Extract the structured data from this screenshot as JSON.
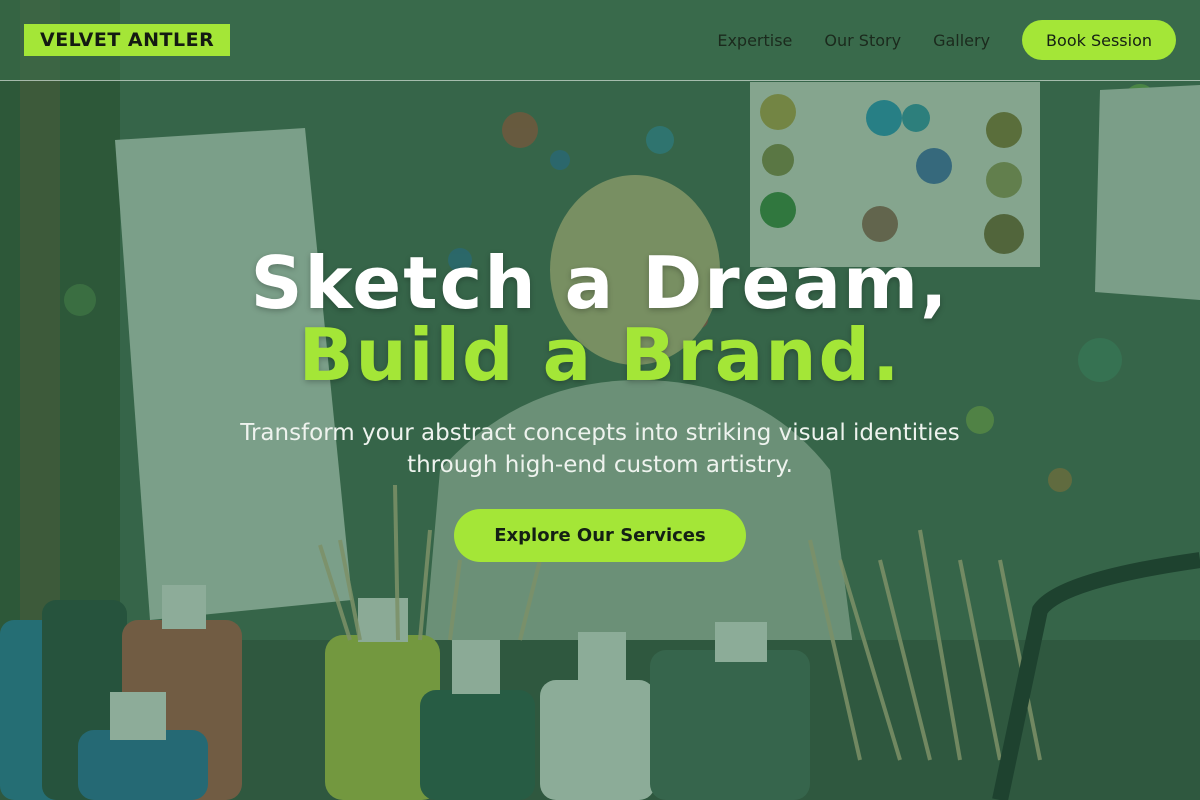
{
  "brand": {
    "logo_text": "VELVET ANTLER"
  },
  "nav": {
    "links": [
      "Expertise",
      "Our Story",
      "Gallery"
    ],
    "cta_label": "Book Session"
  },
  "hero": {
    "headline_line1": "Sketch a Dream,",
    "headline_line2": "Build a Brand.",
    "subtitle_line1": "Transform your abstract concepts into striking visual identities",
    "subtitle_line2": "through high-end custom artistry.",
    "cta_label": "Explore Our Services"
  },
  "colors": {
    "accent": "#a4e637",
    "overlay": "#20603e",
    "headline_white": "#ffffff"
  },
  "background": {
    "description_icon": "art-studio-photo"
  }
}
